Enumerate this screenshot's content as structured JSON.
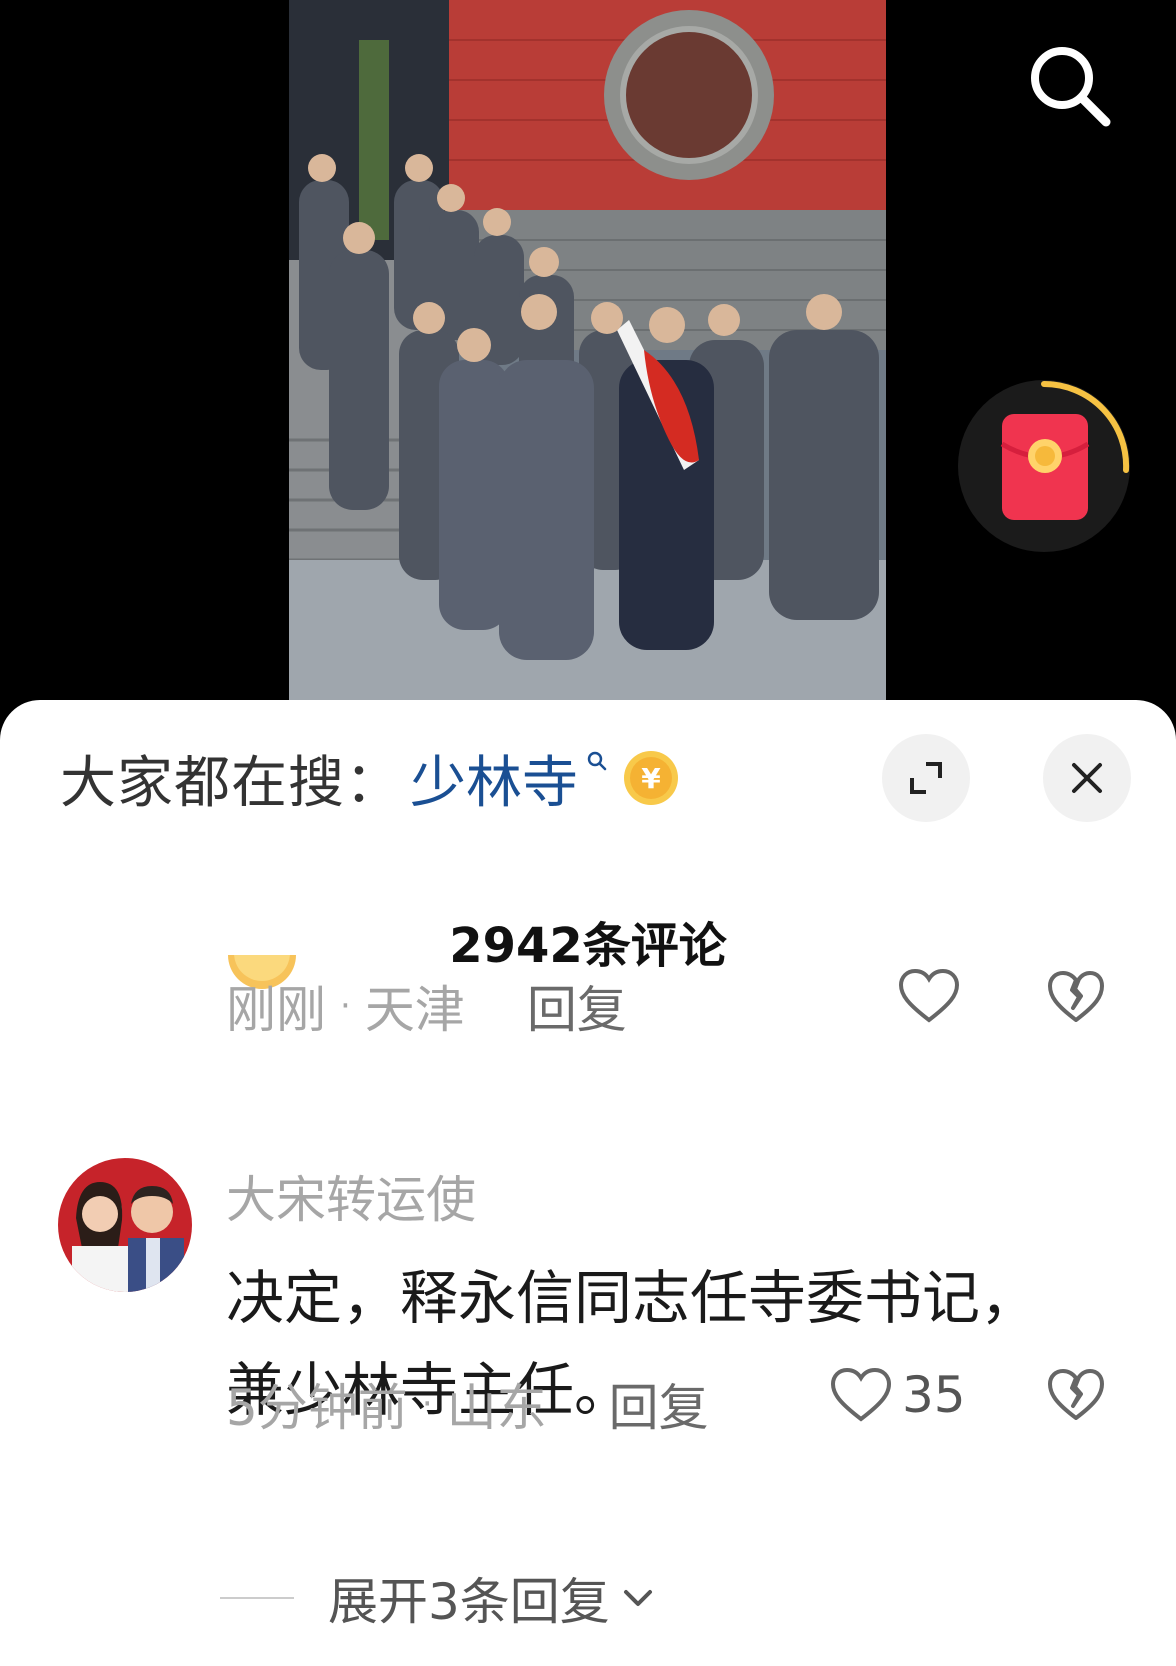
{
  "video": {
    "description_icons": [
      "search-icon",
      "red-packet-icon"
    ]
  },
  "sheet": {
    "hot_search": {
      "label": "大家都在搜：",
      "term": "少林寺",
      "icons": [
        "search-icon",
        "coin-icon"
      ]
    },
    "controls": [
      "expand-icon",
      "close-icon"
    ],
    "comment_count": "2942条评论",
    "comments": [
      {
        "time": "刚刚",
        "location": "天津",
        "reply_label": "回复"
      },
      {
        "username": "大宋转运使",
        "text_line1": "决定，释永信同志任寺委书记，",
        "text_line2": "兼少林寺主任。",
        "time": "5分钟前",
        "location": "山东",
        "reply_label": "回复",
        "likes": "35",
        "expand_replies": "展开3条回复"
      }
    ]
  },
  "colors": {
    "hot_term": "#1a4f93",
    "meta_gray": "#a6a6a6",
    "red_packet": "#f0344f",
    "ring": "#f6c243"
  }
}
